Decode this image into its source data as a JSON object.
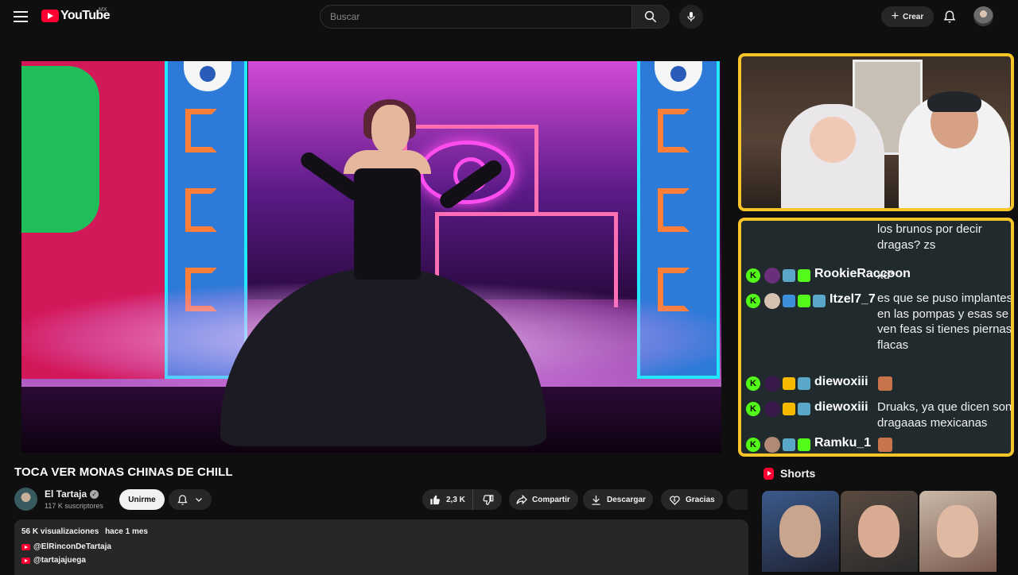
{
  "header": {
    "logo_text": "YouTube",
    "country_code": "MX",
    "search_placeholder": "Buscar",
    "create_label": "Crear",
    "icons": [
      "menu-icon",
      "search-icon",
      "microphone-icon",
      "plus-icon",
      "bell-icon"
    ]
  },
  "chat": {
    "rows": [
      {
        "user": "RookieRaccoon",
        "message": "xd*"
      },
      {
        "user": "Itzel7_7",
        "message": "es que se puso implantes en las pompas y esas se ven feas si tienes piernas flacas"
      },
      {
        "user": "diewoxiii",
        "message": ""
      },
      {
        "user": "diewoxiii",
        "message": "Druaks, ya que dicen son dragaaas mexicanas"
      },
      {
        "user": "Ramku_1",
        "message": ""
      }
    ],
    "partial_top_message": "los brunos por decir dragas? zs",
    "accent_color": "#f7c52a",
    "platform_badge": "K"
  },
  "video": {
    "title": "TOCA VER MONAS CHINAS DE CHILL",
    "channel_name": "El Tartaja",
    "subscribers": "117 K suscriptores",
    "join_label": "Unirme",
    "likes": "2,3 K",
    "share_label": "Compartir",
    "download_label": "Descargar",
    "thanks_label": "Gracias"
  },
  "description": {
    "views": "56 K visualizaciones",
    "date": "hace 1 mes",
    "links": [
      "@ElRinconDeTartaja",
      "@tartajajuega"
    ]
  },
  "shorts": {
    "title": "Shorts"
  }
}
